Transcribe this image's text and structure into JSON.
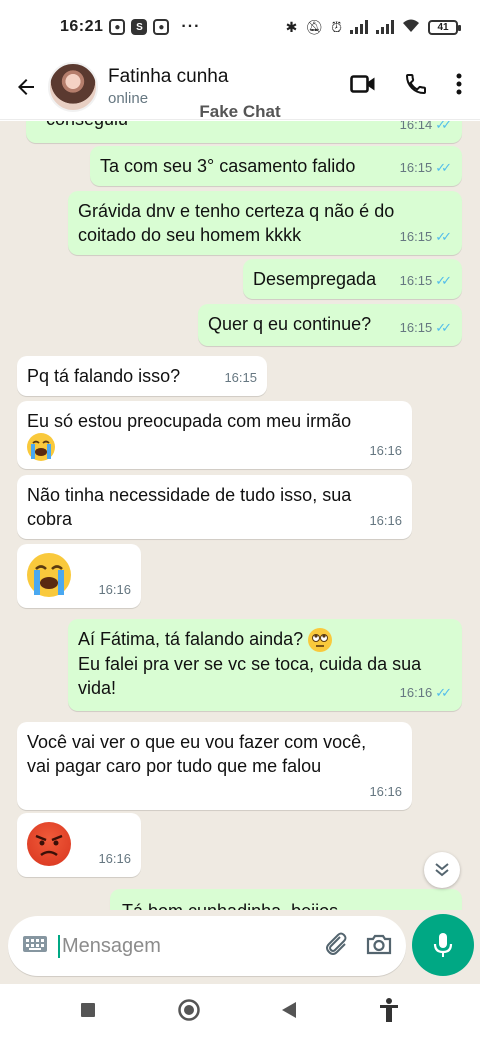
{
  "status": {
    "time": "16:21",
    "battery": "41",
    "dots": "···",
    "app_icon_s": "S"
  },
  "header": {
    "contact_name": "Fatinha cunha",
    "contact_status": "online",
    "watermark": "Fake Chat"
  },
  "messages": [
    {
      "dir": "out",
      "text": "conseguiu",
      "time": "16:14",
      "read": true
    },
    {
      "dir": "out",
      "text": "Ta com seu 3° casamento falido",
      "time": "16:15",
      "read": true
    },
    {
      "dir": "out",
      "text": "Grávida dnv e tenho certeza q não é do coitado do seu homem kkkk",
      "time": "16:15",
      "read": true
    },
    {
      "dir": "out",
      "text": "Desempregada",
      "time": "16:15",
      "read": true
    },
    {
      "dir": "out",
      "text": "Quer q eu continue?",
      "time": "16:15",
      "read": true
    },
    {
      "dir": "in",
      "text": "Pq tá falando isso?",
      "time": "16:15"
    },
    {
      "dir": "in",
      "text": "Eu só estou preocupada com meu irmão",
      "time": "16:16",
      "emoji": "loudly-crying-face-emoji"
    },
    {
      "dir": "in",
      "text": "Não tinha necessidade de tudo isso, sua cobra",
      "time": "16:16"
    },
    {
      "dir": "in",
      "text": "",
      "time": "16:16",
      "emoji": "loudly-crying-face-emoji"
    },
    {
      "dir": "out",
      "text_line1": "Aí Fátima, tá falando ainda?",
      "text_rest": "Eu falei pra ver se vc se toca, cuida da sua vida!",
      "time": "16:16",
      "read": true,
      "emoji": "face-with-rolling-eyes-emoji"
    },
    {
      "dir": "in",
      "text": "Você vai ver o que eu vou fazer com você, vai pagar caro por tudo que me falou",
      "time": "16:16"
    },
    {
      "dir": "in",
      "text": "",
      "time": "16:16",
      "emoji": "pouting-face-emoji"
    },
    {
      "dir": "out",
      "text": "Tá bom cunhadinha, beijos",
      "partial": true
    }
  ],
  "composer": {
    "placeholder": "Mensagem"
  },
  "icons": {
    "back": "arrow-left-icon",
    "video": "video-camera-icon",
    "call": "phone-icon",
    "menu": "more-vertical-icon",
    "keyboard": "keyboard-icon",
    "attach": "paperclip-icon",
    "camera": "camera-icon",
    "mic": "microphone-icon",
    "scroll": "double-chevron-down-icon",
    "nav_recents": "square-icon",
    "nav_home": "circle-icon",
    "nav_back": "triangle-back-icon",
    "nav_accessibility": "accessibility-icon"
  },
  "colors": {
    "outgoing_bubble": "#d9fdd3",
    "incoming_bubble": "#ffffff",
    "chat_background": "#efeae2",
    "read_ticks": "#53bdeb",
    "accent": "#00a884"
  }
}
